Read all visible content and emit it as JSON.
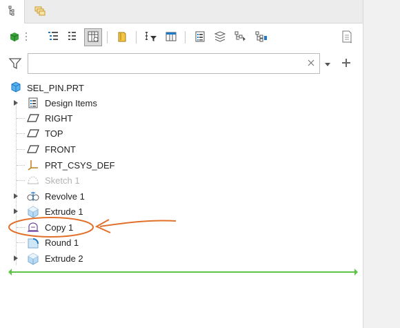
{
  "tabs": [
    {
      "name": "model-tree-tab-icon"
    },
    {
      "name": "layers-tab-icon"
    }
  ],
  "toolbar": [
    {
      "name": "model-display-icon"
    },
    {
      "name": "tree-expand-icon"
    },
    {
      "name": "tree-collapse-icon"
    },
    {
      "name": "tree-columns-icon"
    },
    {
      "name": "insert-folder-icon"
    },
    {
      "name": "tree-filter-icon"
    },
    {
      "name": "tree-settings-icon"
    },
    {
      "name": "show-list-icon"
    },
    {
      "name": "layers-icon"
    },
    {
      "name": "find-icon"
    },
    {
      "name": "hierarchy-icon"
    },
    {
      "name": "notes-icon"
    }
  ],
  "search": {
    "value": "",
    "placeholder": ""
  },
  "tree": {
    "root": {
      "label": "SEL_PIN.PRT",
      "icon": "part-icon"
    },
    "items": [
      {
        "label": "Design Items",
        "icon": "design-items-icon",
        "expandable": true
      },
      {
        "label": "RIGHT",
        "icon": "datum-plane-icon",
        "expandable": false
      },
      {
        "label": "TOP",
        "icon": "datum-plane-icon",
        "expandable": false
      },
      {
        "label": "FRONT",
        "icon": "datum-plane-icon",
        "expandable": false
      },
      {
        "label": "PRT_CSYS_DEF",
        "icon": "csys-icon",
        "expandable": false
      },
      {
        "label": "Sketch 1",
        "icon": "sketch-icon",
        "expandable": false,
        "dim": true
      },
      {
        "label": "Revolve 1",
        "icon": "revolve-icon",
        "expandable": true
      },
      {
        "label": "Extrude 1",
        "icon": "extrude-icon",
        "expandable": true
      },
      {
        "label": "Copy 1",
        "icon": "copy-icon",
        "expandable": false
      },
      {
        "label": "Round 1",
        "icon": "round-icon",
        "expandable": false
      },
      {
        "label": "Extrude 2",
        "icon": "extrude-icon",
        "expandable": true
      }
    ]
  },
  "colors": {
    "accent_blue": "#1e78c8",
    "insert_line": "#5dc447",
    "annotation": "#e0702a"
  }
}
